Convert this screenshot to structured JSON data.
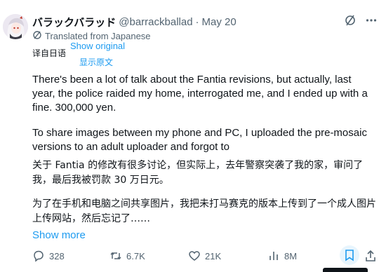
{
  "author": {
    "display_name": "バラックバラッド",
    "handle": "@barrackballad",
    "separator": "·",
    "date": "May 20"
  },
  "translation": {
    "notice": "Translated from Japanese",
    "zh_label": "译自日语",
    "show_original": "Show original",
    "show_original_zh": "显示原文"
  },
  "body": {
    "paragraph_en_1": "There's been a lot of talk about the Fantia revisions, but actually, last year, the police raided my home, interrogated me, and I ended up with a fine. 300,000 yen.",
    "paragraph_en_2": "To share images between my phone and PC, I uploaded the pre-mosaic versions to an adult uploader and forgot to",
    "paragraph_zh_1": "关于 Fantia 的修改有很多讨论，但实际上，去年警察突袭了我的家，审问了我，最后我被罚款 30 万日元。",
    "paragraph_zh_2": "为了在手机和电脑之间共享图片，我把未打马赛克的版本上传到了一个成人图片上传网站，然后忘记了……"
  },
  "show_more": "Show more",
  "actions": {
    "replies": "328",
    "reposts": "6.7K",
    "likes": "21K",
    "views": "8M"
  },
  "icons": {
    "grok": "grok-slash-icon",
    "more": "more-horizontal-icon",
    "translate": "translate-icon",
    "reply": "reply-icon",
    "retweet": "retweet-icon",
    "like": "heart-icon",
    "views": "views-chart-icon",
    "bookmark": "bookmark-icon",
    "share": "share-icon"
  },
  "colors": {
    "text": "#0f1419",
    "secondary": "#536471",
    "link": "#1d9bf0"
  }
}
